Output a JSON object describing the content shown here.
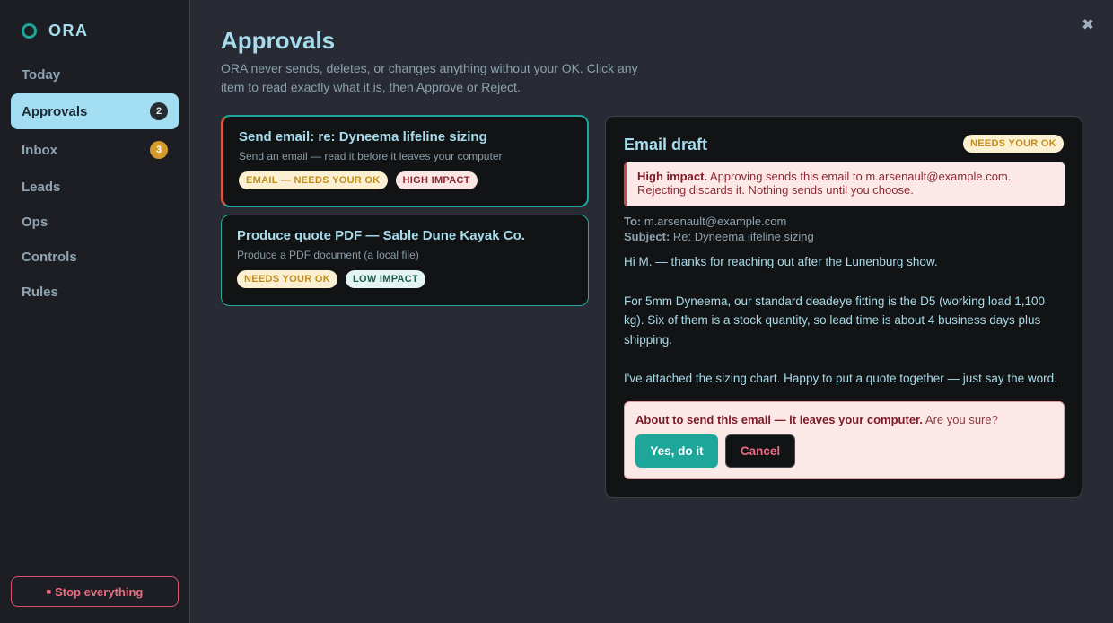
{
  "app": {
    "name": "ORA",
    "close_symbol": "✖",
    "logo_icon": "ring-logo-icon",
    "accent": "#1fa69a"
  },
  "sidebar": {
    "items": [
      {
        "label": "Today",
        "badge": null,
        "active": false
      },
      {
        "label": "Approvals",
        "badge": "2",
        "active": true
      },
      {
        "label": "Inbox",
        "badge": "3",
        "active": false
      },
      {
        "label": "Leads",
        "badge": null,
        "active": false
      },
      {
        "label": "Ops",
        "badge": null,
        "active": false
      },
      {
        "label": "Controls",
        "badge": null,
        "active": false
      },
      {
        "label": "Rules",
        "badge": null,
        "active": false
      }
    ],
    "stop_symbol": "■",
    "stop_label": "Stop everything"
  },
  "page": {
    "title": "Approvals",
    "description": "ORA never sends, deletes, or changes anything without your OK. Click any item to read exactly what it is, then Approve or Reject."
  },
  "approvals": [
    {
      "title": "Send email: re: Dyneema lifeline sizing",
      "subtitle": "Send an email — read it before it leaves your computer",
      "tags": [
        "EMAIL — NEEDS YOUR OK",
        "HIGH IMPACT"
      ],
      "selected": true
    },
    {
      "title": "Produce quote PDF — Sable Dune Kayak Co.",
      "subtitle": "Produce a PDF document (a local file)",
      "tags": [
        "NEEDS YOUR OK",
        "LOW IMPACT"
      ],
      "selected": false
    }
  ],
  "detail": {
    "title": "Email draft",
    "status": "NEEDS YOUR OK",
    "impact_strong": "High impact.",
    "impact_text": " Approving sends this email to m.arsenault@example.com. Rejecting discards it. Nothing sends until you choose.",
    "to_label": "To:",
    "to_value": " m.arsenault@example.com",
    "subject_label": "Subject:",
    "subject_value": " Re: Dyneema lifeline sizing",
    "body": [
      "Hi M. — thanks for reaching out after the Lunenburg show.",
      "For 5mm Dyneema, our standard deadeye fitting is the D5 (working load 1,100 kg). Six of them is a stock quantity, so lead time is about 4 business days plus shipping.",
      "I've attached the sizing chart. Happy to put a quote together — just say the word."
    ],
    "confirm_strong": "About to send this email — it leaves your computer.",
    "confirm_text": " Are you sure?",
    "yes_label": "Yes, do it",
    "cancel_label": "Cancel"
  }
}
